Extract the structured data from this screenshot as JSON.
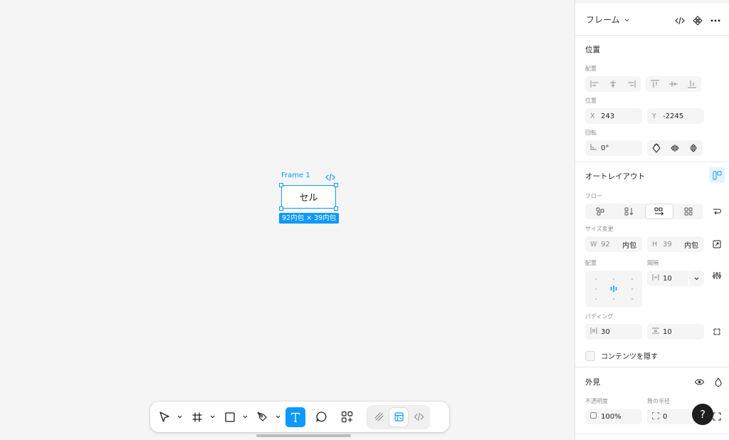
{
  "canvas": {
    "frame_name": "Frame 1",
    "frame_text": "セル",
    "size_badge": "92内包 × 39内包"
  },
  "toolbar": {
    "tools": [
      "move-tool",
      "frame-tool",
      "shape-tool",
      "pen-tool",
      "text-tool",
      "comment-tool",
      "actions-tool"
    ],
    "active_tool": "text-tool",
    "modes": [
      "draw-mode",
      "design-mode",
      "dev-mode"
    ],
    "active_mode": "design-mode"
  },
  "panel": {
    "header": {
      "title": "フレーム"
    },
    "position": {
      "title": "位置",
      "align_label": "配置",
      "position_label": "位置",
      "x_prefix": "X",
      "x_value": "243",
      "y_prefix": "Y",
      "y_value": "-2245",
      "rotation_label": "回転",
      "rotation_value": "0°"
    },
    "autolayout": {
      "title": "オートレイアウト",
      "flow_label": "フロー",
      "resize_label": "サイズ変更",
      "w_prefix": "W",
      "w_value": "92",
      "w_mode": "内包",
      "h_prefix": "H",
      "h_value": "39",
      "h_mode": "内包",
      "align_label": "配置",
      "gap_label": "間隔",
      "gap_value": "10",
      "padding_label": "パディング",
      "padding_h": "30",
      "padding_v": "10",
      "clip_label": "コンテンツを隠す"
    },
    "appearance": {
      "title": "外見",
      "opacity_label": "不透明度",
      "opacity_value": "100%",
      "radius_label": "角の半径",
      "radius_value": "0"
    },
    "help": "?"
  },
  "colors": {
    "accent": "#0d99ff",
    "panel_bg": "#ffffff",
    "canvas_bg": "#f5f5f5"
  }
}
